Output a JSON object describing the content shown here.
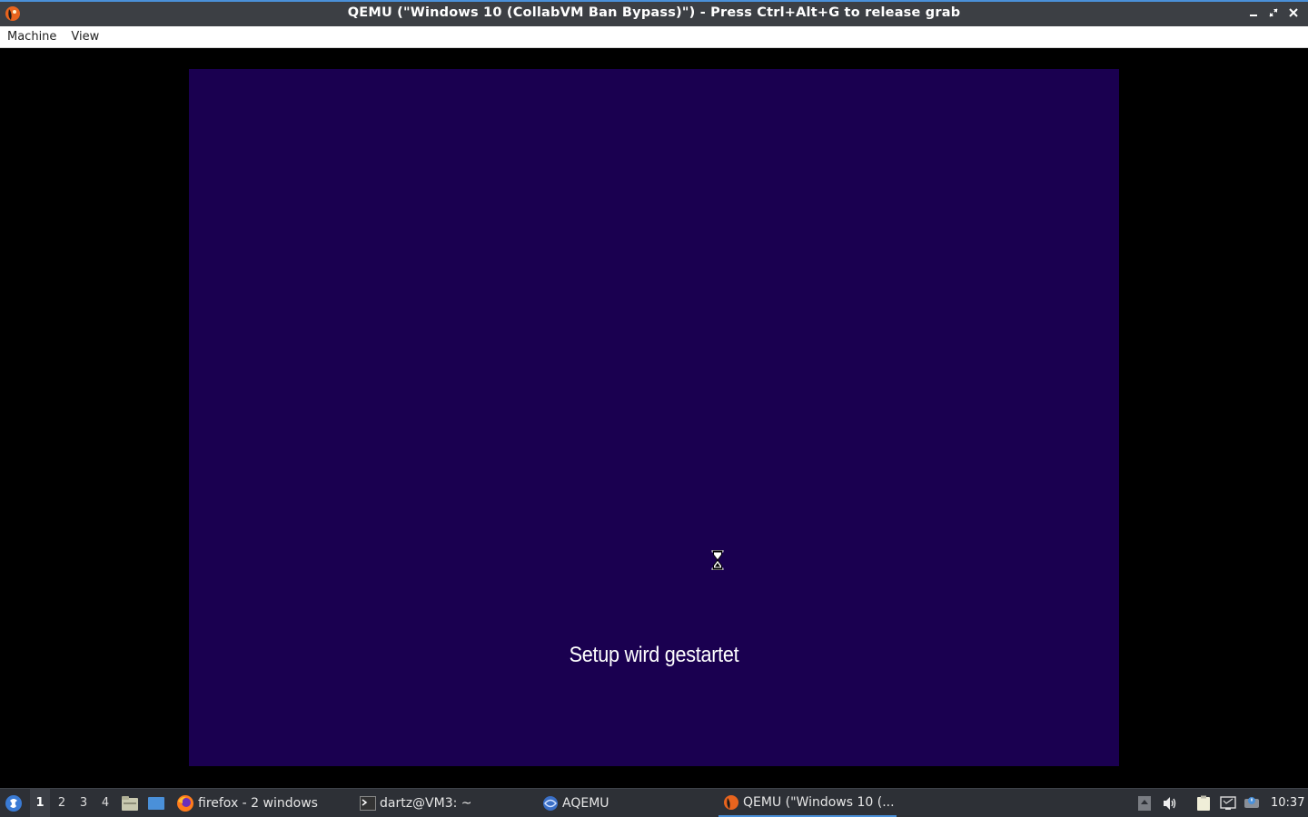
{
  "window": {
    "title": "QEMU (\"Windows 10 (CollabVM Ban Bypass)\") - Press Ctrl+Alt+G to release grab",
    "accent": "#4a90d9"
  },
  "menubar": {
    "items": [
      {
        "label": "Machine"
      },
      {
        "label": "View"
      }
    ]
  },
  "guest": {
    "background": "#1a0050",
    "status_text": "Setup wird gestartet"
  },
  "taskbar": {
    "desktops": [
      "1",
      "2",
      "3",
      "4"
    ],
    "active_desktop": "1",
    "tasks": [
      {
        "label": "firefox - 2 windows",
        "icon": "firefox-icon"
      },
      {
        "label": "dartz@VM3: ~",
        "icon": "terminal-icon"
      },
      {
        "label": "AQEMU",
        "icon": "aqemu-icon"
      },
      {
        "label": "QEMU (\"Windows 10 (...",
        "icon": "qemu-icon"
      }
    ],
    "clock": "10:37"
  }
}
